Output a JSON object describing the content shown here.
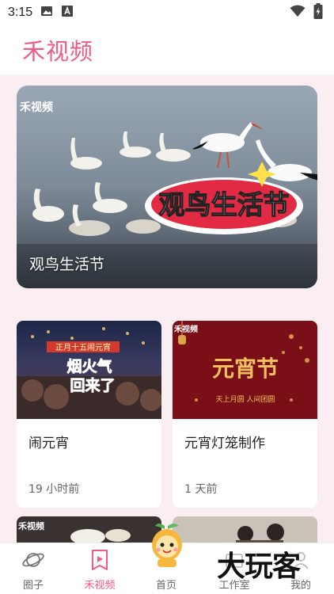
{
  "status_bar": {
    "time": "3:15",
    "icons": [
      "gallery-icon",
      "text-a-icon",
      "wifi-icon",
      "battery-charging-icon"
    ]
  },
  "header": {
    "title": "禾视频"
  },
  "hero": {
    "caption": "观鸟生活节",
    "overlay_title": "观鸟生活节",
    "logo_text": "禾视频"
  },
  "cards": [
    {
      "title": "闹元宵",
      "time": "19 小时前",
      "thumb_text_1": "烟火气",
      "thumb_text_2": "回来了",
      "thumb_banner": "正月十五闹元宵"
    },
    {
      "title": "元宵灯笼制作",
      "time": "1 天前",
      "thumb_text": "元宵节",
      "thumb_sub": "天上月圆 人间团圆",
      "logo_text": "禾视频"
    }
  ],
  "peek": {
    "left_logo": "禾视频"
  },
  "nav": {
    "items": [
      {
        "label": "圈子",
        "icon": "planet-icon"
      },
      {
        "label": "禾视频",
        "icon": "video-bookmark-icon"
      },
      {
        "label": "首页",
        "icon": "mascot-icon"
      },
      {
        "label": "工作室",
        "icon": "studio-icon"
      },
      {
        "label": "我的",
        "icon": "profile-icon"
      }
    ],
    "active": "禾视频"
  },
  "watermark": "大玩客",
  "colors": {
    "accent": "#ef5b86",
    "background": "#faeef3"
  }
}
